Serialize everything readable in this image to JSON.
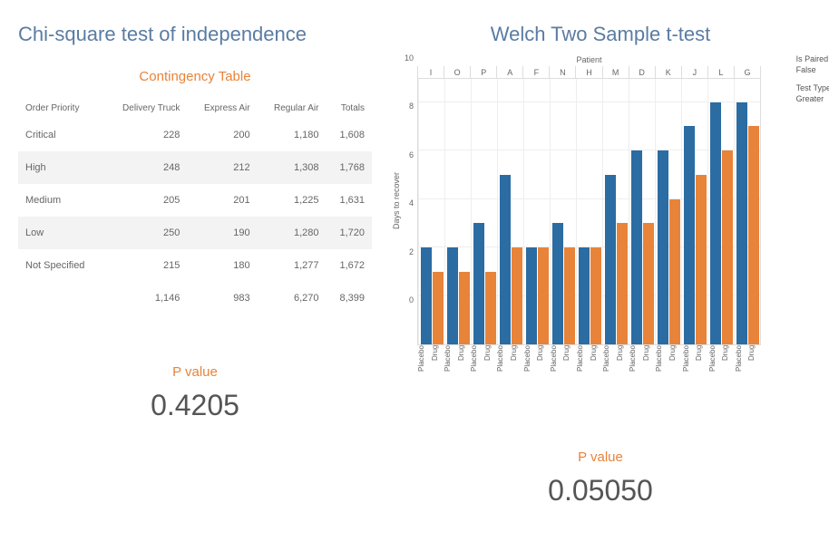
{
  "left": {
    "title": "Chi-square test of independence",
    "subtitle": "Contingency Table",
    "table": {
      "headers": [
        "Order Priority",
        "Delivery Truck",
        "Express Air",
        "Regular Air",
        "Totals"
      ],
      "rows": [
        {
          "label": "Critical",
          "v": [
            "228",
            "200",
            "1,180",
            "1,608"
          ]
        },
        {
          "label": "High",
          "v": [
            "248",
            "212",
            "1,308",
            "1,768"
          ]
        },
        {
          "label": "Medium",
          "v": [
            "205",
            "201",
            "1,225",
            "1,631"
          ]
        },
        {
          "label": "Low",
          "v": [
            "250",
            "190",
            "1,280",
            "1,720"
          ]
        },
        {
          "label": "Not Specified",
          "v": [
            "215",
            "180",
            "1,277",
            "1,672"
          ]
        }
      ],
      "totals": [
        "",
        "1,146",
        "983",
        "6,270",
        "8,399"
      ]
    },
    "pvalue_label": "P value",
    "pvalue": "0.4205"
  },
  "right": {
    "title": "Welch Two Sample t-test",
    "patient_header": "Patient",
    "yaxis_label": "Days to recover",
    "legend": {
      "is_paired_title": "Is Paired",
      "is_paired_value": "False",
      "test_type_title": "Test Type",
      "test_type_value": "Greater"
    },
    "pvalue_label": "P value",
    "pvalue": "0.05050",
    "series_labels": {
      "placebo": "Placebo",
      "drug": "Drug"
    }
  },
  "chart_data": {
    "type": "bar",
    "title": "Welch Two Sample t-test",
    "xlabel": "Patient",
    "ylabel": "Days to recover",
    "ylim": [
      0,
      11
    ],
    "yticks": [
      0,
      2,
      4,
      6,
      8,
      10
    ],
    "categories": [
      "I",
      "O",
      "P",
      "A",
      "F",
      "N",
      "H",
      "M",
      "D",
      "K",
      "J",
      "L",
      "G"
    ],
    "series": [
      {
        "name": "Placebo",
        "color": "#2b6ca3",
        "values": [
          4,
          4,
          5,
          7,
          4,
          5,
          4,
          7,
          8,
          8,
          9,
          10,
          10
        ]
      },
      {
        "name": "Drug",
        "color": "#e8833a",
        "values": [
          3,
          3,
          3,
          4,
          4,
          4,
          4,
          5,
          5,
          6,
          7,
          8,
          9
        ]
      }
    ]
  }
}
